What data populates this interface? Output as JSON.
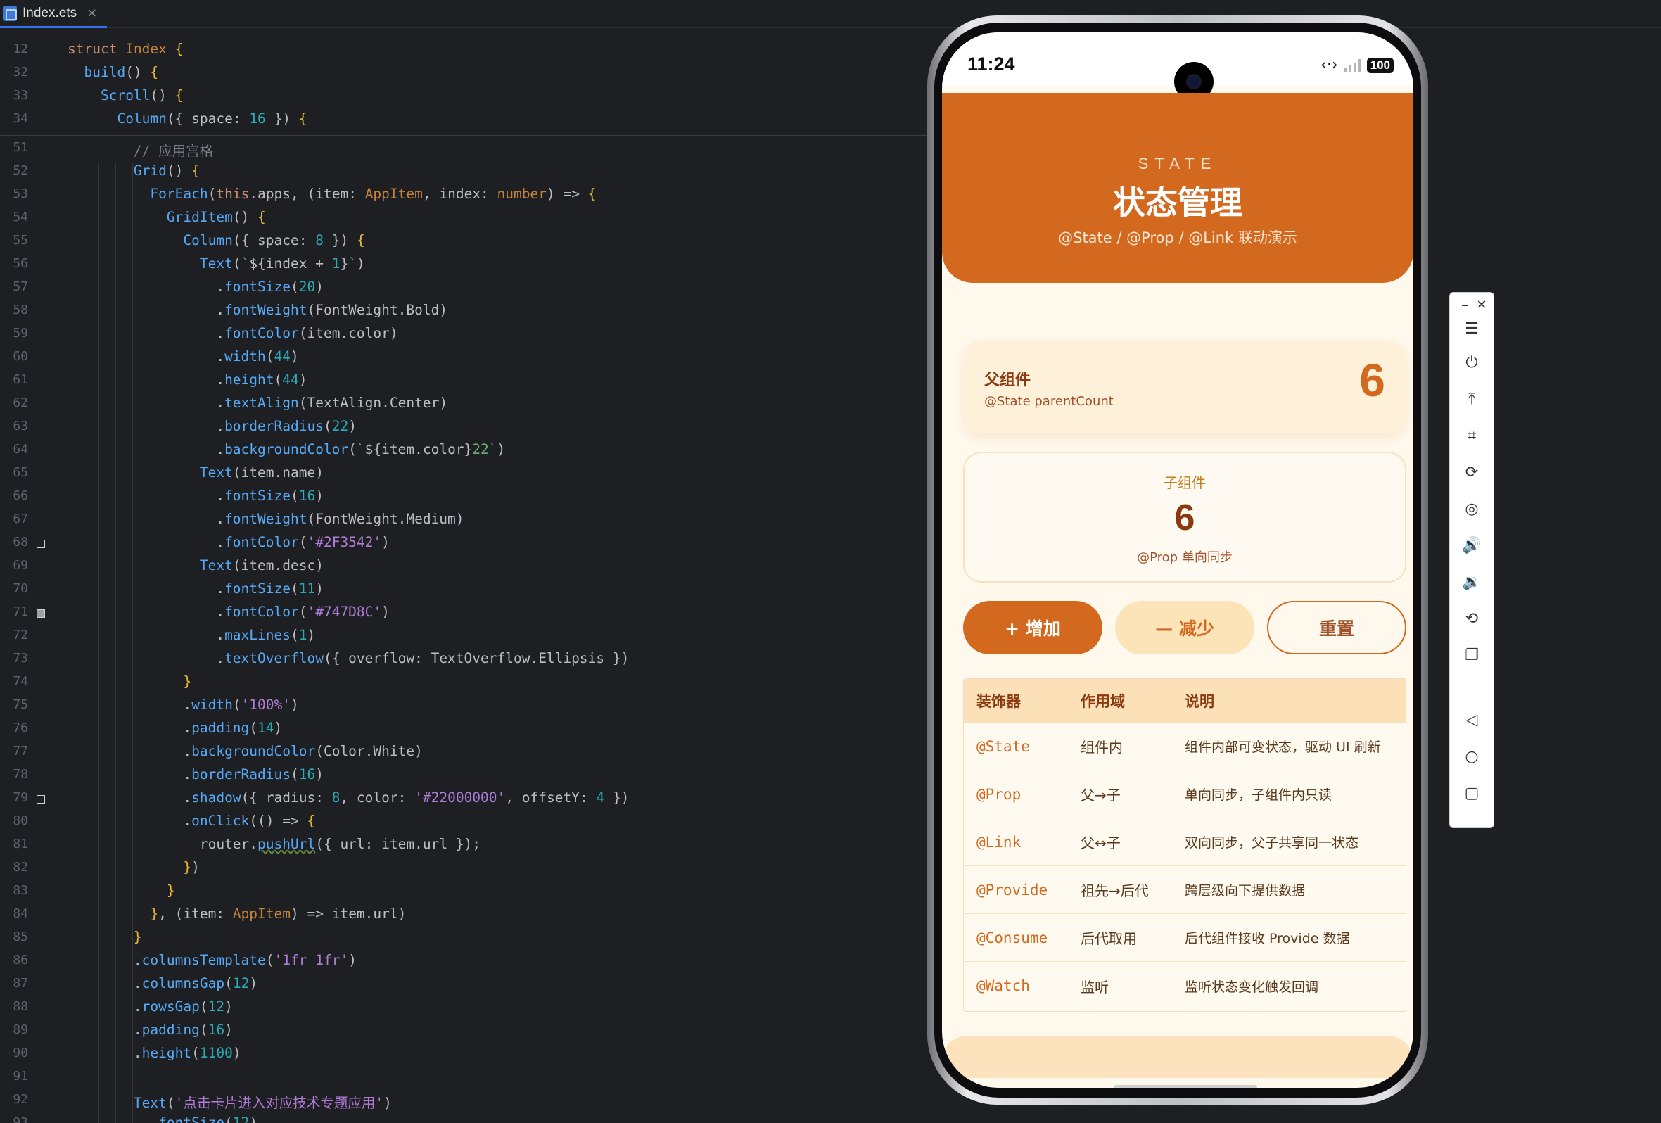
{
  "ide": {
    "tab": {
      "name": "Index.ets",
      "close": "×"
    },
    "lines": [
      {
        "n": "12",
        "html": "<span class=\"kw\">struct</span> <span class=\"tp\">Index</span> <span class=\"y\">{</span>",
        "indent": 0
      },
      {
        "n": "32",
        "html": "  <span class=\"fn\">build</span>() <span class=\"y\">{</span>",
        "indent": 0
      },
      {
        "n": "33",
        "html": "    <span class=\"fn\">Scroll</span>() <span class=\"y\">{</span>",
        "indent": 0
      },
      {
        "n": "34",
        "html": "      <span class=\"fn\">Column</span>({ space: <span class=\"nm\">16</span> }) <span class=\"y\">{</span>",
        "indent": 0
      },
      {
        "n": "51",
        "html": "        <span class=\"cm\">// 应用宫格</span>",
        "indent": 0
      },
      {
        "n": "52",
        "html": "        <span class=\"fn\">Grid</span>() <span class=\"y\">{</span>",
        "indent": 0
      },
      {
        "n": "53",
        "html": "          <span class=\"fn\">ForEach</span>(<span class=\"kw\">this</span>.apps, (item: <span class=\"tp\">AppItem</span>, index: <span class=\"tp\">number</span>) => <span class=\"y\">{</span>",
        "indent": 0
      },
      {
        "n": "54",
        "html": "            <span class=\"fn\">GridItem</span>() <span class=\"y\">{</span>",
        "indent": 0
      },
      {
        "n": "55",
        "html": "              <span class=\"fn\">Column</span>({ space: <span class=\"nm\">8</span> }) <span class=\"y\">{</span>",
        "indent": 0
      },
      {
        "n": "56",
        "html": "                <span class=\"fn\">Text</span>(<span class=\"str2\">`</span>${index + <span class=\"nm\">1</span>}<span class=\"str2\">`</span>)",
        "indent": 0
      },
      {
        "n": "57",
        "html": "                  .<span class=\"mt\">fontSize</span>(<span class=\"nm\">20</span>)",
        "indent": 0
      },
      {
        "n": "58",
        "html": "                  .<span class=\"mt\">fontWeight</span>(FontWeight.Bold)",
        "indent": 0
      },
      {
        "n": "59",
        "html": "                  .<span class=\"mt\">fontColor</span>(item.color)",
        "indent": 0
      },
      {
        "n": "60",
        "html": "                  .<span class=\"mt\">width</span>(<span class=\"nm\">44</span>)",
        "indent": 0
      },
      {
        "n": "61",
        "html": "                  .<span class=\"mt\">height</span>(<span class=\"nm\">44</span>)",
        "indent": 0
      },
      {
        "n": "62",
        "html": "                  .<span class=\"mt\">textAlign</span>(TextAlign.Center)",
        "indent": 0
      },
      {
        "n": "63",
        "html": "                  .<span class=\"mt\">borderRadius</span>(<span class=\"nm\">22</span>)",
        "indent": 0
      },
      {
        "n": "64",
        "html": "                  .<span class=\"mt\">backgroundColor</span>(<span class=\"str2\">`</span>${item.color}<span class=\"str2\">22`</span>)",
        "indent": 0
      },
      {
        "n": "65",
        "html": "                <span class=\"fn\">Text</span>(item.name)",
        "indent": 0
      },
      {
        "n": "66",
        "html": "                  .<span class=\"mt\">fontSize</span>(<span class=\"nm\">16</span>)",
        "indent": 0
      },
      {
        "n": "67",
        "html": "                  .<span class=\"mt\">fontWeight</span>(FontWeight.Medium)",
        "indent": 0
      },
      {
        "n": "68",
        "html": "                  .<span class=\"mt\">fontColor</span>(<span class=\"stv\">'#2F3542'</span>)",
        "indent": 0
      },
      {
        "n": "69",
        "html": "                <span class=\"fn\">Text</span>(item.desc)",
        "indent": 0
      },
      {
        "n": "70",
        "html": "                  .<span class=\"mt\">fontSize</span>(<span class=\"nm\">11</span>)",
        "indent": 0
      },
      {
        "n": "71",
        "html": "                  .<span class=\"mt\">fontColor</span>(<span class=\"stv\">'#747D8C'</span>)",
        "indent": 0
      },
      {
        "n": "72",
        "html": "                  .<span class=\"mt\">maxLines</span>(<span class=\"nm\">1</span>)",
        "indent": 0
      },
      {
        "n": "73",
        "html": "                  .<span class=\"mt\">textOverflow</span>({ overflow: TextOverflow.Ellipsis })",
        "indent": 0
      },
      {
        "n": "74",
        "html": "              <span class=\"y\">}</span>",
        "indent": 0
      },
      {
        "n": "75",
        "html": "              .<span class=\"mt\">width</span>(<span class=\"stv\">'100%'</span>)",
        "indent": 0
      },
      {
        "n": "76",
        "html": "              .<span class=\"mt\">padding</span>(<span class=\"nm\">14</span>)",
        "indent": 0
      },
      {
        "n": "77",
        "html": "              .<span class=\"mt\">backgroundColor</span>(Color.White)",
        "indent": 0
      },
      {
        "n": "78",
        "html": "              .<span class=\"mt\">borderRadius</span>(<span class=\"nm\">16</span>)",
        "indent": 0
      },
      {
        "n": "79",
        "html": "              .<span class=\"mt\">shadow</span>({ radius: <span class=\"nm\">8</span>, color: <span class=\"stv\">'#22000000'</span>, offsetY: <span class=\"nm\">4</span> })",
        "indent": 0
      },
      {
        "n": "80",
        "html": "              .<span class=\"mt\">onClick</span>(() => <span class=\"y\">{</span>",
        "indent": 0
      },
      {
        "n": "81",
        "html": "                router.<span class=\"mt under\">pushUrl</span>({ url: item.url });",
        "indent": 0
      },
      {
        "n": "82",
        "html": "              <span class=\"y\">}</span>)",
        "indent": 0
      },
      {
        "n": "83",
        "html": "            <span class=\"y\">}</span>",
        "indent": 0
      },
      {
        "n": "84",
        "html": "          <span class=\"y\">}</span>, (item: <span class=\"tp\">AppItem</span>) => item.url)",
        "indent": 0
      },
      {
        "n": "85",
        "html": "        <span class=\"y\">}</span>",
        "indent": 0
      },
      {
        "n": "86",
        "html": "        .<span class=\"mt\">columnsTemplate</span>(<span class=\"stv\">'1fr 1fr'</span>)",
        "indent": 0
      },
      {
        "n": "87",
        "html": "        .<span class=\"mt\">columnsGap</span>(<span class=\"nm\">12</span>)",
        "indent": 0
      },
      {
        "n": "88",
        "html": "        .<span class=\"mt\">rowsGap</span>(<span class=\"nm\">12</span>)",
        "indent": 0
      },
      {
        "n": "89",
        "html": "        .<span class=\"mt\">padding</span>(<span class=\"nm\">16</span>)",
        "indent": 0
      },
      {
        "n": "90",
        "html": "        .<span class=\"mt\">height</span>(<span class=\"nm\">1100</span>)",
        "indent": 0
      },
      {
        "n": "91",
        "html": "",
        "indent": 0
      },
      {
        "n": "92",
        "html": "        <span class=\"fn\">Text</span>(<span class=\"stv\">'点击卡片进入对应技术专题应用'</span>)",
        "indent": 0
      },
      {
        "n": "93",
        "html": "          .<span class=\"mt\">fontSize</span>(<span class=\"nm\">12</span>)",
        "indent": 0
      }
    ]
  },
  "phone": {
    "status": {
      "time": "11:24",
      "battery": "100"
    },
    "header": {
      "en": "STATE",
      "title": "状态管理",
      "subtitle": "@State / @Prop / @Link 联动演示"
    },
    "parent": {
      "title": "父组件",
      "subtitle": "@State parentCount",
      "value": "6"
    },
    "child": {
      "title": "子组件",
      "value": "6",
      "subtitle": "@Prop 单向同步"
    },
    "buttons": {
      "add": "+ 增加",
      "sub": "— 减少",
      "reset": "重置"
    },
    "table": {
      "headers": [
        "装饰器",
        "作用域",
        "说明"
      ],
      "rows": [
        [
          "@State",
          "组件内",
          "组件内部可变状态，驱动 UI 刷新"
        ],
        [
          "@Prop",
          "父→子",
          "单向同步，子组件内只读"
        ],
        [
          "@Link",
          "父↔子",
          "双向同步，父子共享同一状态"
        ],
        [
          "@Provide",
          "祖先→后代",
          "跨层级向下提供数据"
        ],
        [
          "@Consume",
          "后代取用",
          "后代组件接收 Provide 数据"
        ],
        [
          "@Watch",
          "监听",
          "监听状态变化触发回调"
        ]
      ]
    },
    "colors": {
      "accent": "#d2691e",
      "accent_soft": "#fde3b8",
      "background": "#fff8ec"
    }
  },
  "toolbar": {
    "icons": [
      "minimize-icon",
      "close-icon",
      "menu-icon",
      "power-icon",
      "pin-top-icon",
      "crop-icon",
      "rotate-icon",
      "screenshot-icon",
      "volume-up-icon",
      "volume-down-icon",
      "shake-icon",
      "multi-device-icon",
      "back-icon",
      "home-icon",
      "overview-icon"
    ]
  }
}
